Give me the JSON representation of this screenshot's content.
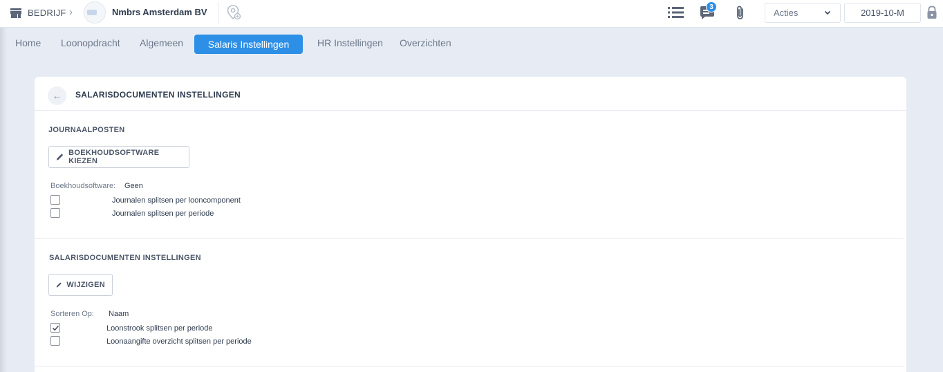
{
  "topbar": {
    "breadcrumb_label": "BEDRIJF",
    "breadcrumb_chevron": "›",
    "company_name": "Nmbrs Amsterdam BV",
    "notifications_count": "3",
    "actions_label": "Acties",
    "period_value": "2019-10-M",
    "icons": [
      "store-icon",
      "location-pin-icon",
      "list-icon",
      "chat-icon",
      "paperclip-icon",
      "chevron-down-icon",
      "lock-icon"
    ]
  },
  "nav": {
    "tabs": [
      {
        "label": "Home"
      },
      {
        "label": "Loonopdracht"
      },
      {
        "label": "Algemeen"
      },
      {
        "label": "Salaris Instellingen",
        "active": true
      },
      {
        "label": "HR Instellingen"
      },
      {
        "label": "Overzichten"
      }
    ]
  },
  "card": {
    "title": "SALARISDOCUMENTEN INSTELLINGEN",
    "back_icon": "←",
    "journaalposten": {
      "title": "JOURNAALPOSTEN",
      "button_label": "BOEKHOUDSOFTWARE KIEZEN",
      "software_label": "Boekhoudsoftware:",
      "software_value": "Geen",
      "checkboxes": [
        {
          "label": "Journalen splitsen per looncomponent",
          "checked": false
        },
        {
          "label": "Journalen splitsen per periode",
          "checked": false
        }
      ]
    },
    "salarisdocumenten": {
      "title": "SALARISDOCUMENTEN INSTELLINGEN",
      "button_label": "WIJZIGEN",
      "sort_label": "Sorteren Op:",
      "sort_value": "Naam",
      "checkboxes": [
        {
          "label": "Loonstrook splitsen per periode",
          "checked": true
        },
        {
          "label": "Loonaangifte overzicht splitsen per periode",
          "checked": false
        }
      ]
    }
  },
  "colors": {
    "accent": "#2d8fe6",
    "background": "#e7ecf4",
    "card": "#ffffff",
    "text": "#2e3b4e"
  }
}
